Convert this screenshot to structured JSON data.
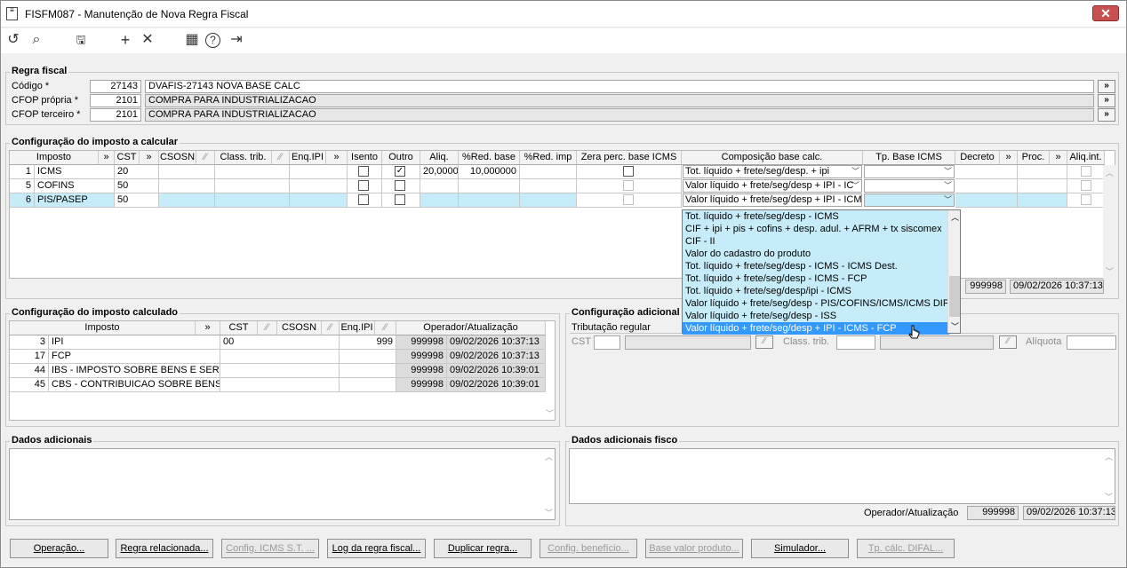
{
  "window": {
    "title": "FISFM087 - Manutenção de Nova Regra Fiscal",
    "close": "✕"
  },
  "toolbar": {
    "undo": "↺",
    "search": "⌕",
    "save": "🖫",
    "add": "+",
    "remove": "✕",
    "calendar": "▦",
    "help": "?",
    "exit": "⇥"
  },
  "regra": {
    "title": "Regra fiscal",
    "codigo_label": "Código *",
    "codigo": "27143",
    "codigo_desc": "DVAFIS-27143 NOVA BASE CALC",
    "cfop_propria_label": "CFOP própria *",
    "cfop_propria": "2101",
    "cfop_propria_desc": "COMPRA PARA INDUSTRIALIZACAO",
    "cfop_terceiro_label": "CFOP terceiro *",
    "cfop_terceiro": "2101",
    "cfop_terceiro_desc": "COMPRA PARA INDUSTRIALIZACAO",
    "more": "»"
  },
  "calc": {
    "title": "Configuração do imposto a calcular",
    "headers": {
      "imposto": "Imposto",
      "cst": "CST",
      "csosn": "CSOSN",
      "class_trib": "Class. trib.",
      "enq_ipi": "Enq.IPI",
      "isento": "Isento",
      "outro": "Outro",
      "aliq": "Aliq.",
      "red_base": "%Red. base",
      "red_imp": "%Red. imp",
      "zera": "Zera perc. base ICMS",
      "comp": "Composição base calc.",
      "tp_base": "Tp. Base ICMS",
      "decreto": "Decreto",
      "proc": "Proc.",
      "aliq_int": "Aliq.int.",
      "more": "»",
      "flt": "⁄⁄"
    },
    "rows": [
      {
        "n": "1",
        "imposto": "ICMS",
        "cst": "20",
        "aliq": "20,0000",
        "red_base": "10,000000",
        "comp": "Tot. líquido + frete/seg/desp. + ipi",
        "outro": "✓"
      },
      {
        "n": "5",
        "imposto": "COFINS",
        "cst": "50",
        "aliq": "",
        "red_base": "",
        "comp": "Valor líquido + frete/seg/desp + IPI - IC",
        "outro": ""
      },
      {
        "n": "6",
        "imposto": "PIS/PASEP",
        "cst": "50",
        "aliq": "",
        "red_base": "",
        "comp": "Valor líquido + frete/seg/desp + IPI - ICMS",
        "outro": ""
      }
    ],
    "operador": "999998",
    "data": "09/02/2026 10:37:13"
  },
  "dropdown": {
    "items": [
      "Tot. líquido + frete/seg/desp - ICMS",
      "CIF + ipi + pis + cofins + desp. adul. + AFRM + tx siscomex",
      "CIF - II",
      "Valor do cadastro do produto",
      "Tot. líquido + frete/seg/desp - ICMS - ICMS Dest.",
      "Tot. líquido + frete/seg/desp - ICMS - FCP",
      "Tot. líquido + frete/seg/desp/ipi - ICMS",
      "Valor líquido + frete/seg/desp - PIS/COFINS/ICMS/ICMS DIFAL",
      "Valor líquido + frete/seg/desp - ISS",
      "Valor líquido + frete/seg/desp + IPI - ICMS - FCP"
    ]
  },
  "calculado": {
    "title": "Configuração do imposto calculado",
    "headers": {
      "imposto": "Imposto",
      "cst": "CST",
      "csosn": "CSOSN",
      "enq_ipi": "Enq.IPI",
      "oper": "Operador/Atualização"
    },
    "rows": [
      {
        "n": "3",
        "imposto": "IPI",
        "cst": "00",
        "enq": "999",
        "op": "999998",
        "dt": "09/02/2026 10:37:13"
      },
      {
        "n": "17",
        "imposto": "FCP",
        "cst": "",
        "enq": "",
        "op": "999998",
        "dt": "09/02/2026 10:37:13"
      },
      {
        "n": "44",
        "imposto": "IBS - IMPOSTO SOBRE BENS E SERVICOS",
        "cst": "",
        "enq": "",
        "op": "999998",
        "dt": "09/02/2026 10:39:01"
      },
      {
        "n": "45",
        "imposto": "CBS - CONTRIBUICAO SOBRE BENS E SERVICOS",
        "cst": "",
        "enq": "",
        "op": "999998",
        "dt": "09/02/2026 10:39:01"
      }
    ]
  },
  "adicional": {
    "title": "Configuração adicional",
    "trib": "Tributação regular",
    "cst": "CST",
    "class_trib": "Class. trib.",
    "aliquota": "Alíquota"
  },
  "dados": {
    "title": "Dados adicionais",
    "fisco_title": "Dados adicionais fisco",
    "oper_label": "Operador/Atualização",
    "operador": "999998",
    "data": "09/02/2026 10:37:13"
  },
  "buttons": [
    "Operação...",
    "Regra relacionada...",
    "Config. ICMS S.T. ...",
    "Log da regra fiscal...",
    "Duplicar regra...",
    "Config. benefício...",
    "Base valor produto...",
    "Simulador...",
    "Tp. cálc. DIFAL..."
  ],
  "colors": {
    "selection": "#c7ecf9",
    "highlight": "#3399ff",
    "close": "#c75050"
  }
}
